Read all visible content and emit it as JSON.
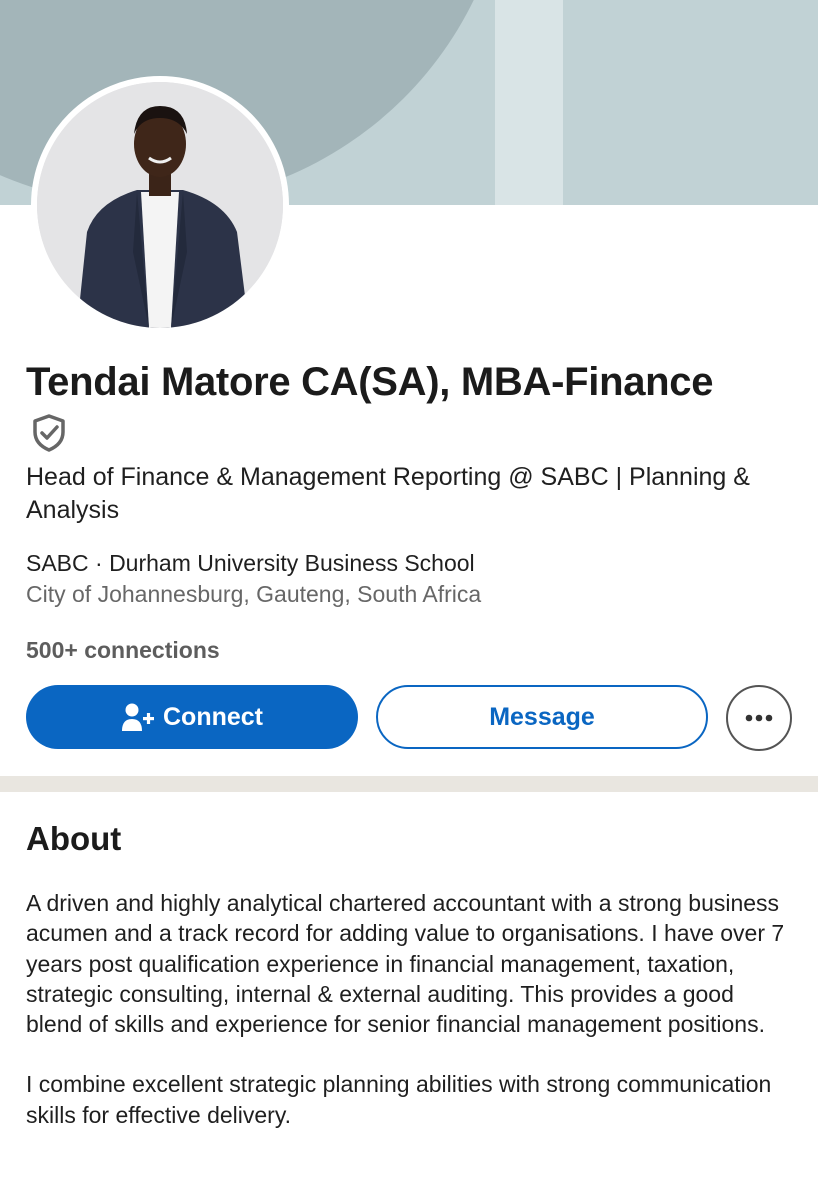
{
  "profile": {
    "name": "Tendai Matore CA(SA), MBA-Finance",
    "headline": "Head of Finance & Management Reporting @ SABC | Planning & Analysis",
    "organizations": "SABC · Durham University Business School",
    "location": "City of Johannesburg, Gauteng, South Africa",
    "connections": "500+ connections"
  },
  "actions": {
    "connect_label": "Connect",
    "message_label": "Message"
  },
  "icons": {
    "verified": "shield-check-icon",
    "connect": "add-person-icon",
    "more": "more-horizontal-icon"
  },
  "about": {
    "title": "About",
    "paragraph_1": "A driven and highly analytical chartered accountant with a strong business acumen and a track record for adding value to organisations. I have over 7 years post qualification experience in financial management, taxation, strategic consulting, internal & external auditing. This provides a good blend of skills and experience for senior financial management positions.",
    "paragraph_2": "I combine excellent strategic planning abilities with strong communication skills for effective delivery."
  },
  "colors": {
    "accent": "#0a66c2",
    "banner_light": "#c1d2d5",
    "banner_dark": "#a3b5b9",
    "section_divider": "#e9e6e0"
  }
}
